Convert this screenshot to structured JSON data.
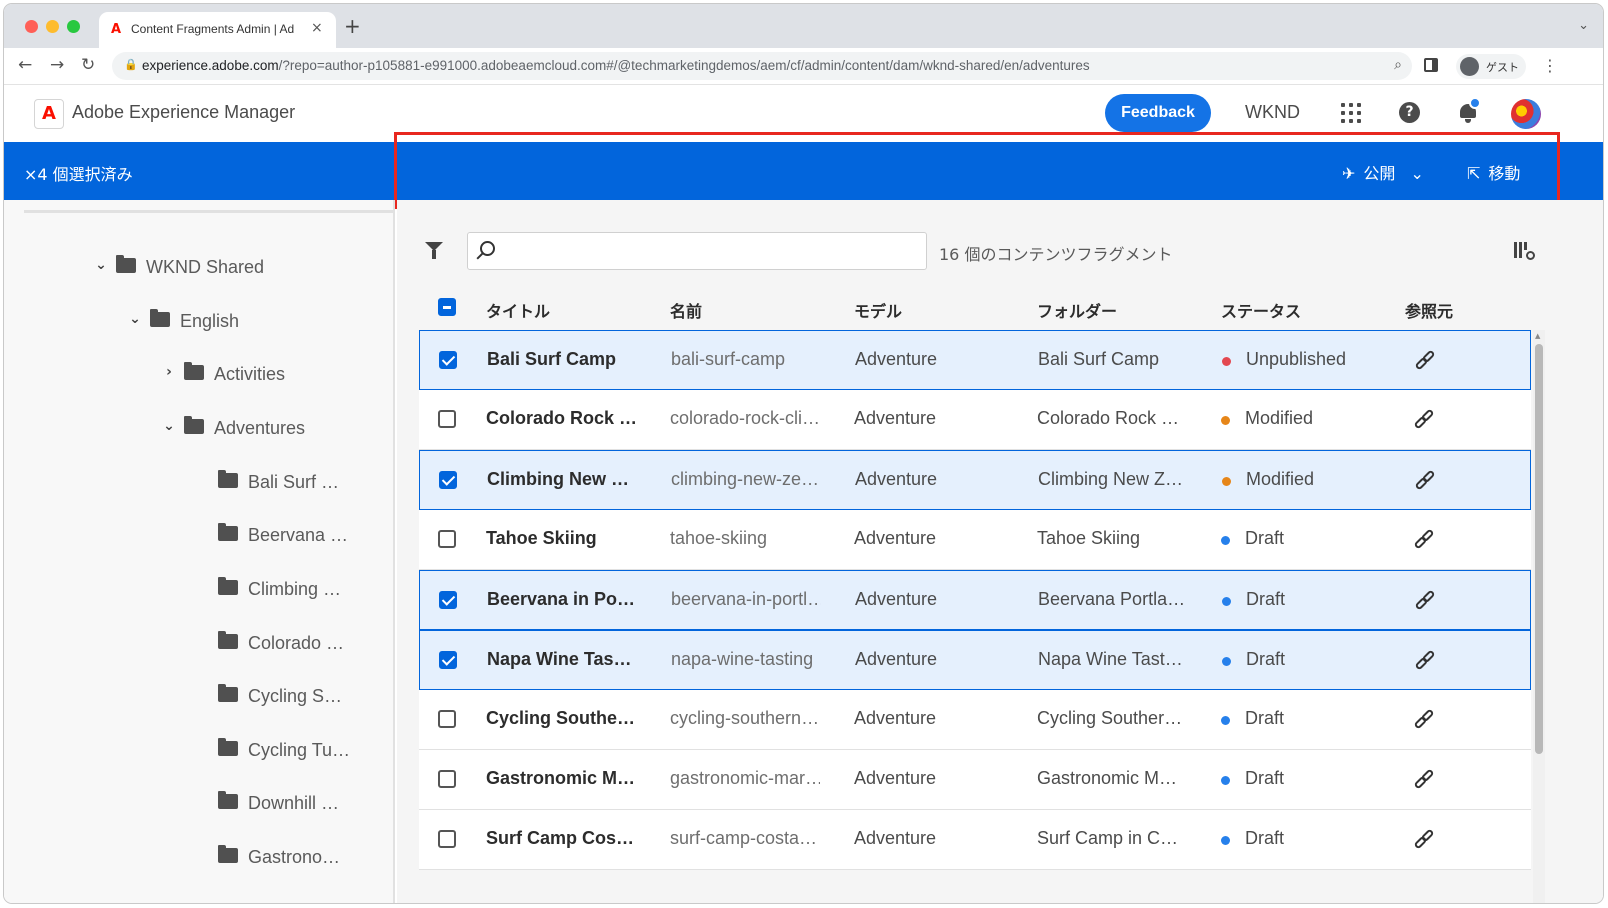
{
  "browser": {
    "tab_title": "Content Fragments Admin | Ad",
    "url_host": "experience.adobe.com",
    "url_rest": "/?repo=author-p105881-e991000.adobeaemcloud.com#/@techmarketingdemos/aem/cf/admin/content/dam/wknd-shared/en/adventures",
    "guest_label": "ゲスト",
    "icons": [
      "back-icon",
      "forward-icon",
      "reload-icon",
      "lock-icon",
      "zoom-icon",
      "side-panel-icon",
      "menu-icon"
    ]
  },
  "header": {
    "product_name": "Adobe Experience Manager",
    "feedback_label": "Feedback",
    "org_name": "WKND"
  },
  "selection_bar": {
    "count_label": "×4 個選択済み",
    "publish_label": "公開",
    "move_label": "移動"
  },
  "tree": [
    {
      "label": "WKND Shared",
      "expanded": true
    },
    {
      "label": "English",
      "expanded": true
    },
    {
      "label": "Activities",
      "expanded": false
    },
    {
      "label": "Adventures",
      "expanded": true
    },
    {
      "label": "Bali Surf …"
    },
    {
      "label": "Beervana …"
    },
    {
      "label": "Climbing …"
    },
    {
      "label": "Colorado …"
    },
    {
      "label": "Cycling S…"
    },
    {
      "label": "Cycling Tu…"
    },
    {
      "label": "Downhill …"
    },
    {
      "label": "Gastrono…"
    }
  ],
  "toolbar": {
    "search_placeholder": "",
    "result_count": "16 個のコンテンツフラグメント"
  },
  "table": {
    "columns": [
      "タイトル",
      "名前",
      "モデル",
      "フォルダー",
      "ステータス",
      "参照元"
    ],
    "rows": [
      {
        "title": "Bali Surf Camp",
        "name": "bali-surf-camp",
        "model": "Adventure",
        "folder": "Bali Surf Camp",
        "status": "Unpublished",
        "selected": true
      },
      {
        "title": "Colorado Rock …",
        "name": "colorado-rock-cli…",
        "model": "Adventure",
        "folder": "Colorado Rock …",
        "status": "Modified",
        "selected": false
      },
      {
        "title": "Climbing New …",
        "name": "climbing-new-ze…",
        "model": "Adventure",
        "folder": "Climbing New Z…",
        "status": "Modified",
        "selected": true
      },
      {
        "title": "Tahoe Skiing",
        "name": "tahoe-skiing",
        "model": "Adventure",
        "folder": "Tahoe Skiing",
        "status": "Draft",
        "selected": false
      },
      {
        "title": "Beervana in Po…",
        "name": "beervana-in-portl…",
        "model": "Adventure",
        "folder": "Beervana Portla…",
        "status": "Draft",
        "selected": true
      },
      {
        "title": "Napa Wine Tas…",
        "name": "napa-wine-tasting",
        "model": "Adventure",
        "folder": "Napa Wine Tast…",
        "status": "Draft",
        "selected": true
      },
      {
        "title": "Cycling Southe…",
        "name": "cycling-southern…",
        "model": "Adventure",
        "folder": "Cycling Souther…",
        "status": "Draft",
        "selected": false
      },
      {
        "title": "Gastronomic M…",
        "name": "gastronomic-mar…",
        "model": "Adventure",
        "folder": "Gastronomic M…",
        "status": "Draft",
        "selected": false
      },
      {
        "title": "Surf Camp Cos…",
        "name": "surf-camp-costa…",
        "model": "Adventure",
        "folder": "Surf Camp in C…",
        "status": "Draft",
        "selected": false
      }
    ]
  },
  "colors": {
    "accent": "#0265dc",
    "status_unpublished": "#e34850",
    "status_modified": "#e68619",
    "status_draft": "#2680eb",
    "highlight": "#e8271f"
  }
}
